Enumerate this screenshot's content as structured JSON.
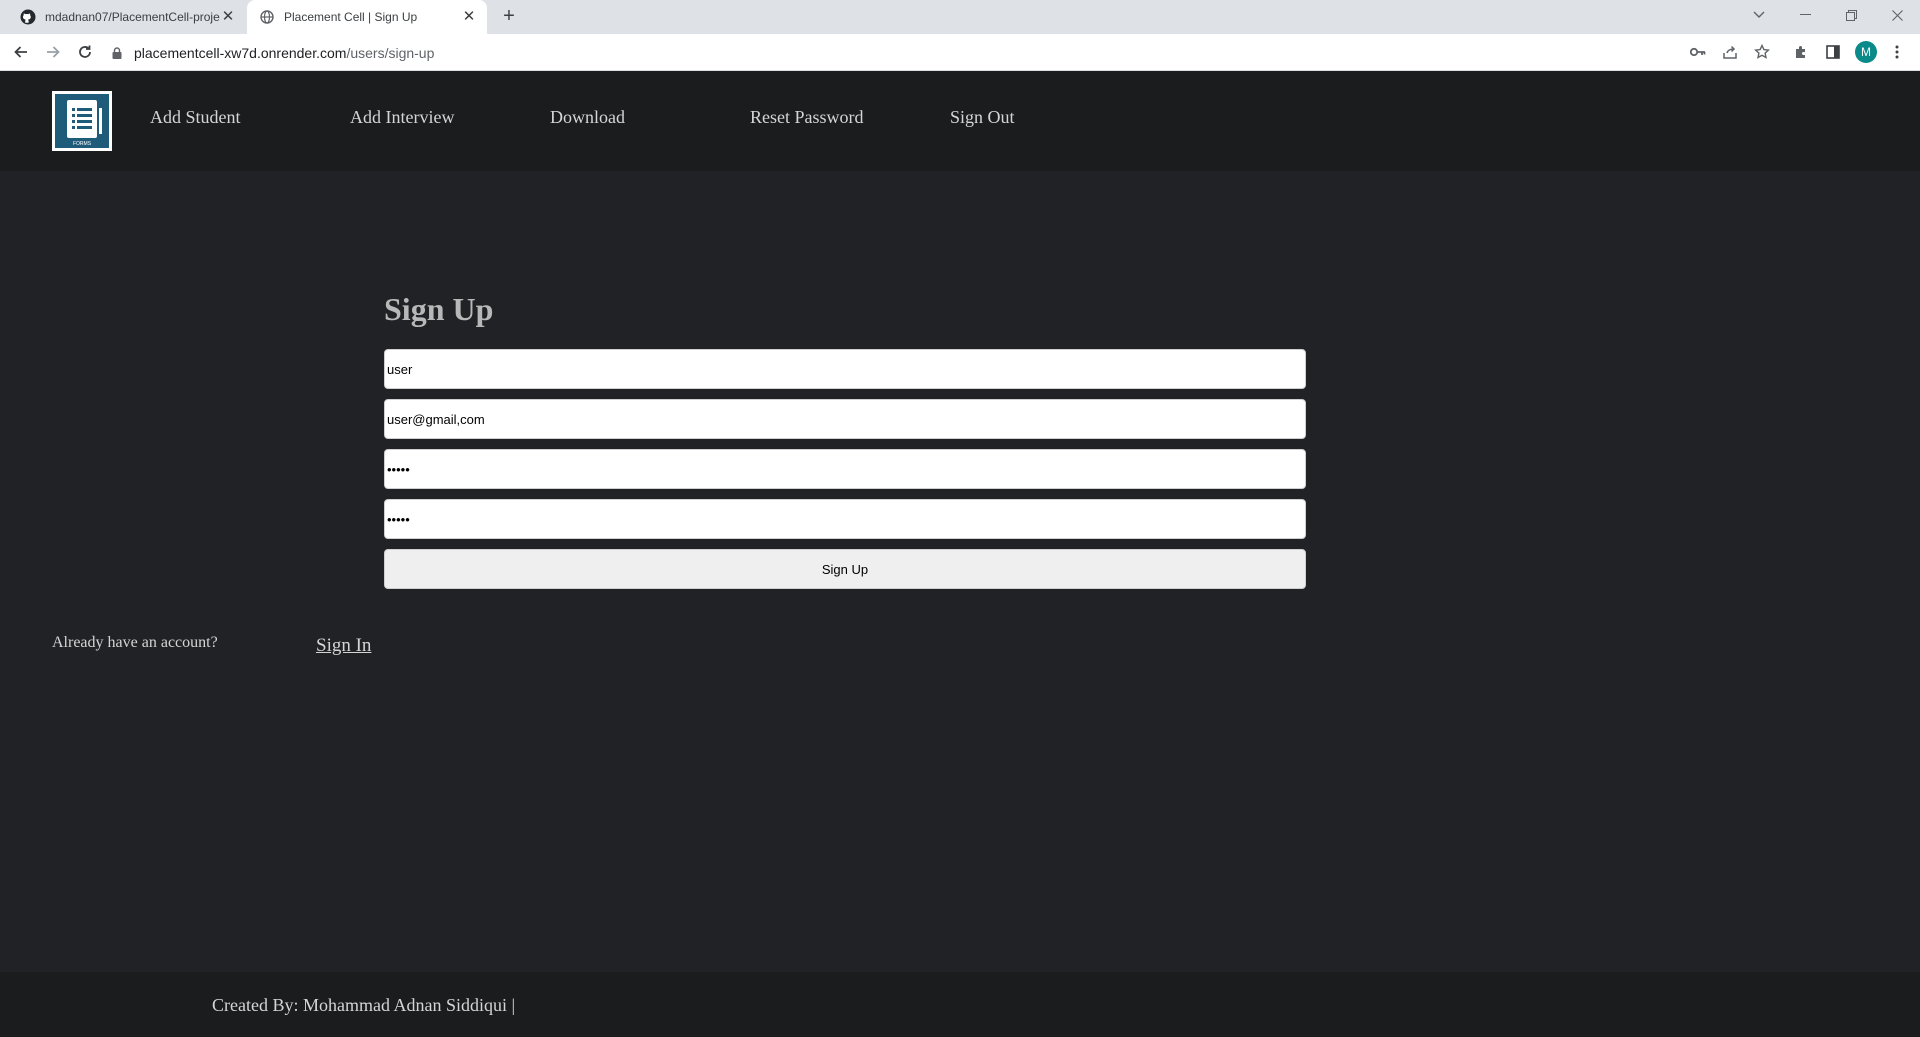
{
  "browser": {
    "tabs": [
      {
        "title": "mdadnan07/PlacementCell-proje",
        "icon": "github-icon",
        "active": false
      },
      {
        "title": "Placement Cell | Sign Up",
        "icon": "globe-icon",
        "active": true
      }
    ],
    "new_tab_label": "+",
    "url_host": "placementcell-xw7d.onrender.com",
    "url_path": "/users/sign-up",
    "profile_initial": "M",
    "profile_color": "#0b8a8a"
  },
  "header": {
    "logo_text": "FORMS",
    "nav": [
      {
        "label": "Add Student"
      },
      {
        "label": "Add Interview"
      },
      {
        "label": "Download"
      },
      {
        "label": "Reset Password"
      },
      {
        "label": "Sign Out"
      }
    ]
  },
  "form": {
    "title": "Sign Up",
    "name_value": "user",
    "email_value": "user@gmail,com",
    "password_value": "•••••",
    "confirm_password_value": "•••••",
    "submit_label": "Sign Up"
  },
  "signin_prompt": {
    "text": "Already have an account?",
    "link_label": "Sign In"
  },
  "footer": {
    "credit": "Created By: Mohammad Adnan Siddiqui |"
  },
  "colors": {
    "page_bg": "#212226",
    "header_bg": "#1b1c1e",
    "text": "#d5d5d5",
    "title": "#b8b8b8"
  }
}
